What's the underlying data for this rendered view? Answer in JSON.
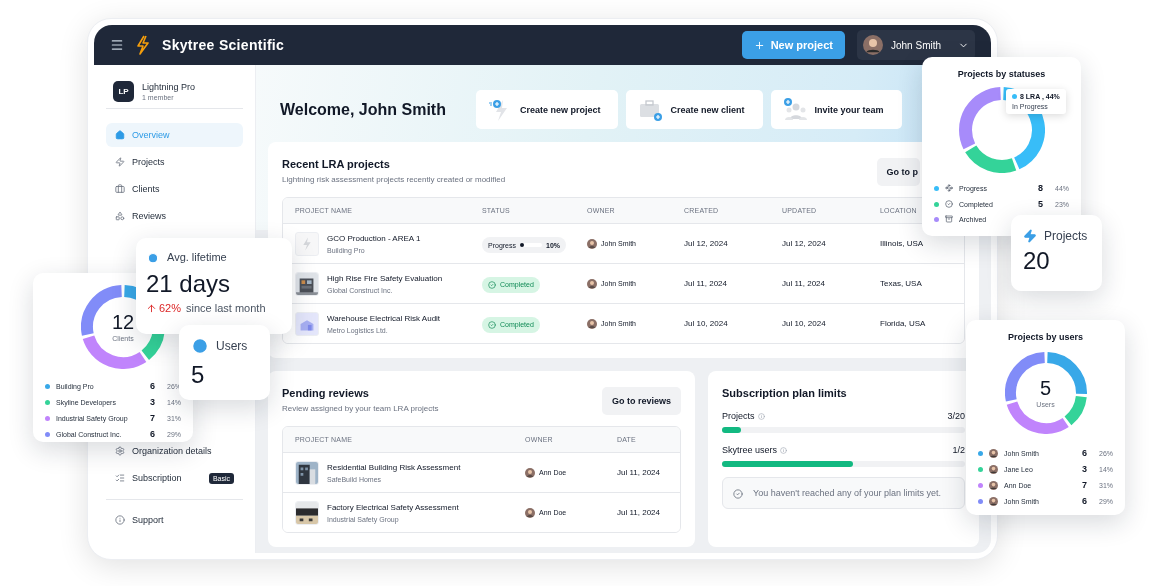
{
  "topbar": {
    "brand": "Skytree Scientific",
    "new_project": "New project",
    "user": "John Smith"
  },
  "sidebar": {
    "org": {
      "initials": "LP",
      "name": "Lightning Pro",
      "members": "1 member"
    },
    "items": [
      {
        "label": "Overview",
        "selected": true
      },
      {
        "label": "Projects",
        "selected": false
      },
      {
        "label": "Clients",
        "selected": false
      },
      {
        "label": "Reviews",
        "selected": false
      }
    ],
    "bottom_items": [
      {
        "label": "Organization details"
      },
      {
        "label": "Subscription",
        "badge": "Basic"
      },
      {
        "label": "Support"
      }
    ]
  },
  "welcome": "Welcome, John Smith",
  "actions": [
    {
      "label": "Create new project"
    },
    {
      "label": "Create new client"
    },
    {
      "label": "Invite your team"
    }
  ],
  "recent": {
    "title": "Recent LRA projects",
    "subtitle": "Lightning risk assessment projects recently created or modified",
    "button": "Go to p",
    "columns": [
      "PROJECT NAME",
      "STATUS",
      "OWNER",
      "CREATED",
      "UPDATED",
      "LOCATION"
    ],
    "rows": [
      {
        "name": "GCO Production - AREA 1",
        "client": "Building Pro",
        "status": {
          "kind": "progress",
          "label": "Progress",
          "level": 0.1,
          "reading": "10%"
        },
        "owner": "John Smith",
        "created": "Jul 12, 2024",
        "updated": "Jul 12, 2024",
        "location": "Illinois, USA"
      },
      {
        "name": "High Rise Fire Safety Evaluation",
        "client": "Global Construct Inc.",
        "status": {
          "kind": "completed",
          "label": "Completed"
        },
        "owner": "John Smith",
        "created": "Jul 11, 2024",
        "updated": "Jul 11, 2024",
        "location": "Texas, USA"
      },
      {
        "name": "Warehouse Electrical Risk Audit",
        "client": "Metro Logistics Ltd.",
        "status": {
          "kind": "completed",
          "label": "Completed"
        },
        "owner": "John Smith",
        "created": "Jul 10, 2024",
        "updated": "Jul 10, 2024",
        "location": "Florida, USA"
      }
    ]
  },
  "pending": {
    "title": "Pending reviews",
    "subtitle": "Review assigned by your team LRA projects",
    "button": "Go to reviews",
    "columns": [
      "PROJECT NAME",
      "OWNER",
      "DATE"
    ],
    "rows": [
      {
        "name": "Residential Building Risk Assessment",
        "client": "SafeBuild Homes",
        "owner": "Ann Doe",
        "date": "Jul 11, 2024"
      },
      {
        "name": "Factory Electrical Safety Assessment",
        "client": "Industrial Safety Group",
        "owner": "Ann Doe",
        "date": "Jul 11, 2024"
      }
    ]
  },
  "limits": {
    "title": "Subscription plan limits",
    "items": [
      {
        "label": "Projects",
        "reading": "3/20",
        "level": 0.08
      },
      {
        "label": "Skytree users",
        "reading": "1/2",
        "level": 0.54
      }
    ],
    "note": "You haven't reached any of your plan limits yet."
  },
  "statuses_card": {
    "title": "Projects by statuses",
    "tooltip": {
      "value": "8 LRA , 44%",
      "label": "In Progress"
    },
    "legend": [
      {
        "label": "Progress",
        "color": "#38bdf8",
        "count": "8",
        "share": "44%"
      },
      {
        "label": "Completed",
        "color": "#34d399",
        "count": "5",
        "share": "23%"
      },
      {
        "label": "Archived",
        "color": "#a78bfa"
      }
    ]
  },
  "projects_stat": {
    "label": "Projects",
    "value": "20"
  },
  "lifetime": {
    "label": "Avg. lifetime",
    "value": "21 days",
    "change": "62%",
    "note": "since last month"
  },
  "clients_card": {
    "total": "12",
    "unit": "Clients",
    "legend": [
      {
        "label": "Building Pro",
        "color": "#38a8e8",
        "count": "6",
        "share": "26%"
      },
      {
        "label": "Skyline Developers",
        "color": "#34d399",
        "count": "3",
        "share": "14%"
      },
      {
        "label": "Industrial Safety Group",
        "color": "#c084fc",
        "count": "7",
        "share": "31%"
      },
      {
        "label": "Global Construct Inc.",
        "color": "#818cf8",
        "count": "6",
        "share": "29%"
      }
    ]
  },
  "users_stat": {
    "label": "Users",
    "value": "5"
  },
  "users_card": {
    "title": "Projects by users",
    "total": "5",
    "unit": "Users",
    "legend": [
      {
        "label": "John Smith",
        "color": "#38a8e8",
        "count": "6",
        "share": "26%"
      },
      {
        "label": "Jane Leo",
        "color": "#34d399",
        "count": "3",
        "share": "14%"
      },
      {
        "label": "Ann Doe",
        "color": "#c084fc",
        "count": "7",
        "share": "31%"
      },
      {
        "label": "John Smith",
        "color": "#818cf8",
        "count": "6",
        "share": "29%"
      }
    ]
  }
}
